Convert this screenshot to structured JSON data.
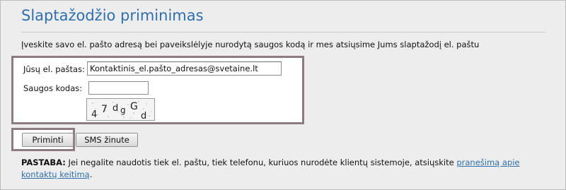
{
  "page": {
    "title": "Slaptažodžio priminimas",
    "intro": "Įveskite savo el. pašto adresą bei paveikslėlyje nurodytą saugos kodą ir mes atsiųsime Jums slaptažodį el. paštu"
  },
  "form": {
    "email_label": "Jūsų el. paštas:",
    "email_value": "Kontaktinis_el.pašto_adresas@svetaine.lt",
    "code_label": "Saugos kodas:",
    "code_value": "",
    "captcha_chars": [
      "4",
      "7",
      "d",
      "g",
      "G",
      "d"
    ]
  },
  "buttons": {
    "remind_label": "Priminti",
    "sms_label": "SMS žinute"
  },
  "note": {
    "prefix": "PASTABA:",
    "text": " Jei negalite naudotis tiek el. paštu, tiek telefonu, kuriuos nurodėte klientų sistemoje, atsiųskite ",
    "link": "pranešimą apie kontaktų keitimą",
    "suffix": "."
  },
  "colors": {
    "title": "#2f6fb0",
    "highlight_border": "#8e7b80",
    "panel_bg": "#ededed"
  }
}
